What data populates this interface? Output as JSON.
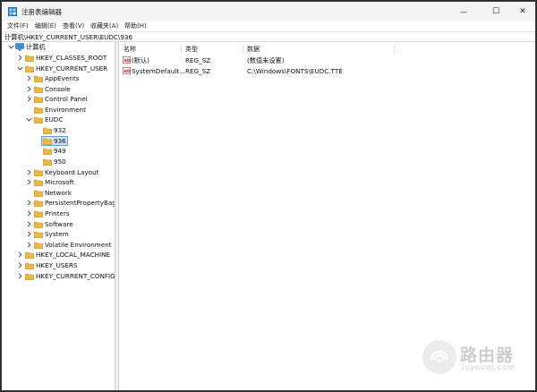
{
  "window": {
    "title": "注册表编辑器",
    "controls": {
      "minimize": "—",
      "maximize": "☐",
      "close": "✕"
    }
  },
  "menu": [
    "文件(F)",
    "编辑(E)",
    "查看(V)",
    "收藏夹(A)",
    "帮助(H)"
  ],
  "address": "计算机\\HKEY_CURRENT_USER\\EUDC\\936",
  "tree": {
    "computer": "计算机",
    "nodes": [
      {
        "label": "HKEY_CLASSES_ROOT"
      },
      {
        "label": "HKEY_CURRENT_USER"
      },
      {
        "label": "AppEvents"
      },
      {
        "label": "Console"
      },
      {
        "label": "Control Panel"
      },
      {
        "label": "Environment"
      },
      {
        "label": "EUDC"
      },
      {
        "label": "932"
      },
      {
        "label": "936"
      },
      {
        "label": "949"
      },
      {
        "label": "950"
      },
      {
        "label": "Keyboard Layout"
      },
      {
        "label": "Microsoft"
      },
      {
        "label": "Network"
      },
      {
        "label": "PersistentPropertyBag"
      },
      {
        "label": "Printers"
      },
      {
        "label": "Software"
      },
      {
        "label": "System"
      },
      {
        "label": "Volatile Environment"
      },
      {
        "label": "HKEY_LOCAL_MACHINE"
      },
      {
        "label": "HKEY_USERS"
      },
      {
        "label": "HKEY_CURRENT_CONFIG"
      }
    ]
  },
  "list": {
    "headers": {
      "name": "名称",
      "type": "类型",
      "data": "数据"
    },
    "rows": [
      {
        "name": "(默认)",
        "type": "REG_SZ",
        "data": "(数值未设置)"
      },
      {
        "name": "SystemDefault...",
        "type": "REG_SZ",
        "data": "C:\\Windows\\FONTS\\EUDC.TTE"
      }
    ]
  },
  "watermark": {
    "main": "路由器",
    "sub": "luyouqi.com"
  },
  "colors": {
    "folder": "#e8b84a",
    "selection": "#cce4f7",
    "accent": "#0067c0"
  }
}
